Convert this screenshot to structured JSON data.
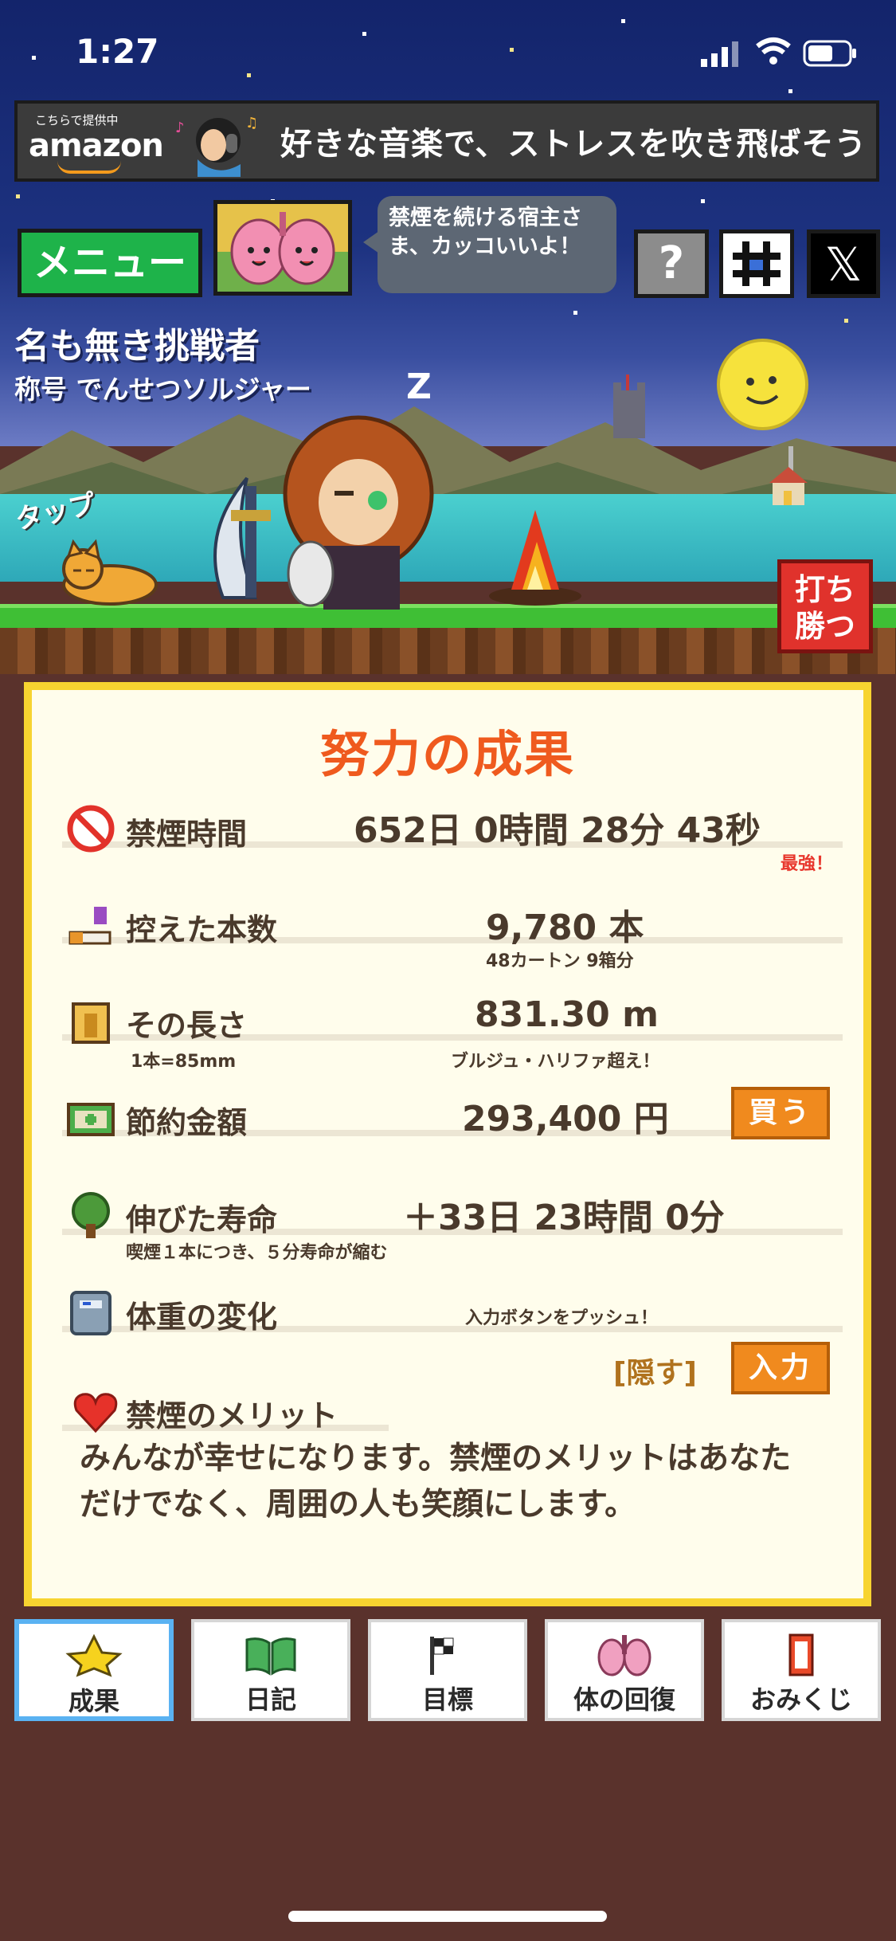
{
  "status_bar": {
    "time": "1:27"
  },
  "ad": {
    "provider_small": "こちらで提供中",
    "provider": "amazon",
    "text": "好きな音楽で、ストレスを吹き飛ばそう"
  },
  "top_bar": {
    "menu_label": "メニュー",
    "bubble_text": "禁煙を続ける宿主さま、カッコいいよ！",
    "help_label": "?",
    "x_label": "𝕏"
  },
  "player": {
    "name": "名も無き挑戦者",
    "title": "称号 でんせつソルジャー",
    "sleep_mark": "Z"
  },
  "scene": {
    "tap_label": "タップ",
    "fight_label_1": "打ち",
    "fight_label_2": "勝つ"
  },
  "results": {
    "title": "努力の成果",
    "smoke_free_time": {
      "label": "禁煙時間",
      "value": "652日 0時間 28分 43秒",
      "note": "最強！"
    },
    "cigarettes_avoided": {
      "label": "控えた本数",
      "value": "9,780 本",
      "note": "48カートン 9箱分"
    },
    "length": {
      "label": "その長さ",
      "sub": "1本=85mm",
      "value": "831.30 m",
      "note": "ブルジュ・ハリファ超え！"
    },
    "savings": {
      "label": "節約金額",
      "value": "293,400 円",
      "button": "買う"
    },
    "life_extended": {
      "label": "伸びた寿命",
      "value": "＋33日 23時間 0分",
      "note": "喫煙１本につき、５分寿命が縮む"
    },
    "weight_change": {
      "label": "体重の変化",
      "note": "入力ボタンをプッシュ！",
      "hide_label": "[隠す]",
      "button": "入力"
    },
    "merit": {
      "label": "禁煙のメリット",
      "text_1": "みんなが幸せになります。禁煙のメリットはあなた",
      "text_2": "だけでなく、周囲の人も笑顔にします。"
    }
  },
  "tabs": [
    {
      "label": "成果",
      "icon": "star-icon",
      "active": true
    },
    {
      "label": "日記",
      "icon": "book-icon",
      "active": false
    },
    {
      "label": "目標",
      "icon": "flag-icon",
      "active": false
    },
    {
      "label": "体の回復",
      "icon": "lungs-icon",
      "active": false
    },
    {
      "label": "おみくじ",
      "icon": "fortune-icon",
      "active": false
    }
  ],
  "colors": {
    "accent": "#ef5a1e",
    "panel_border": "#f7d430",
    "button_orange": "#f08a1e",
    "menu_green": "#1eb34a"
  }
}
